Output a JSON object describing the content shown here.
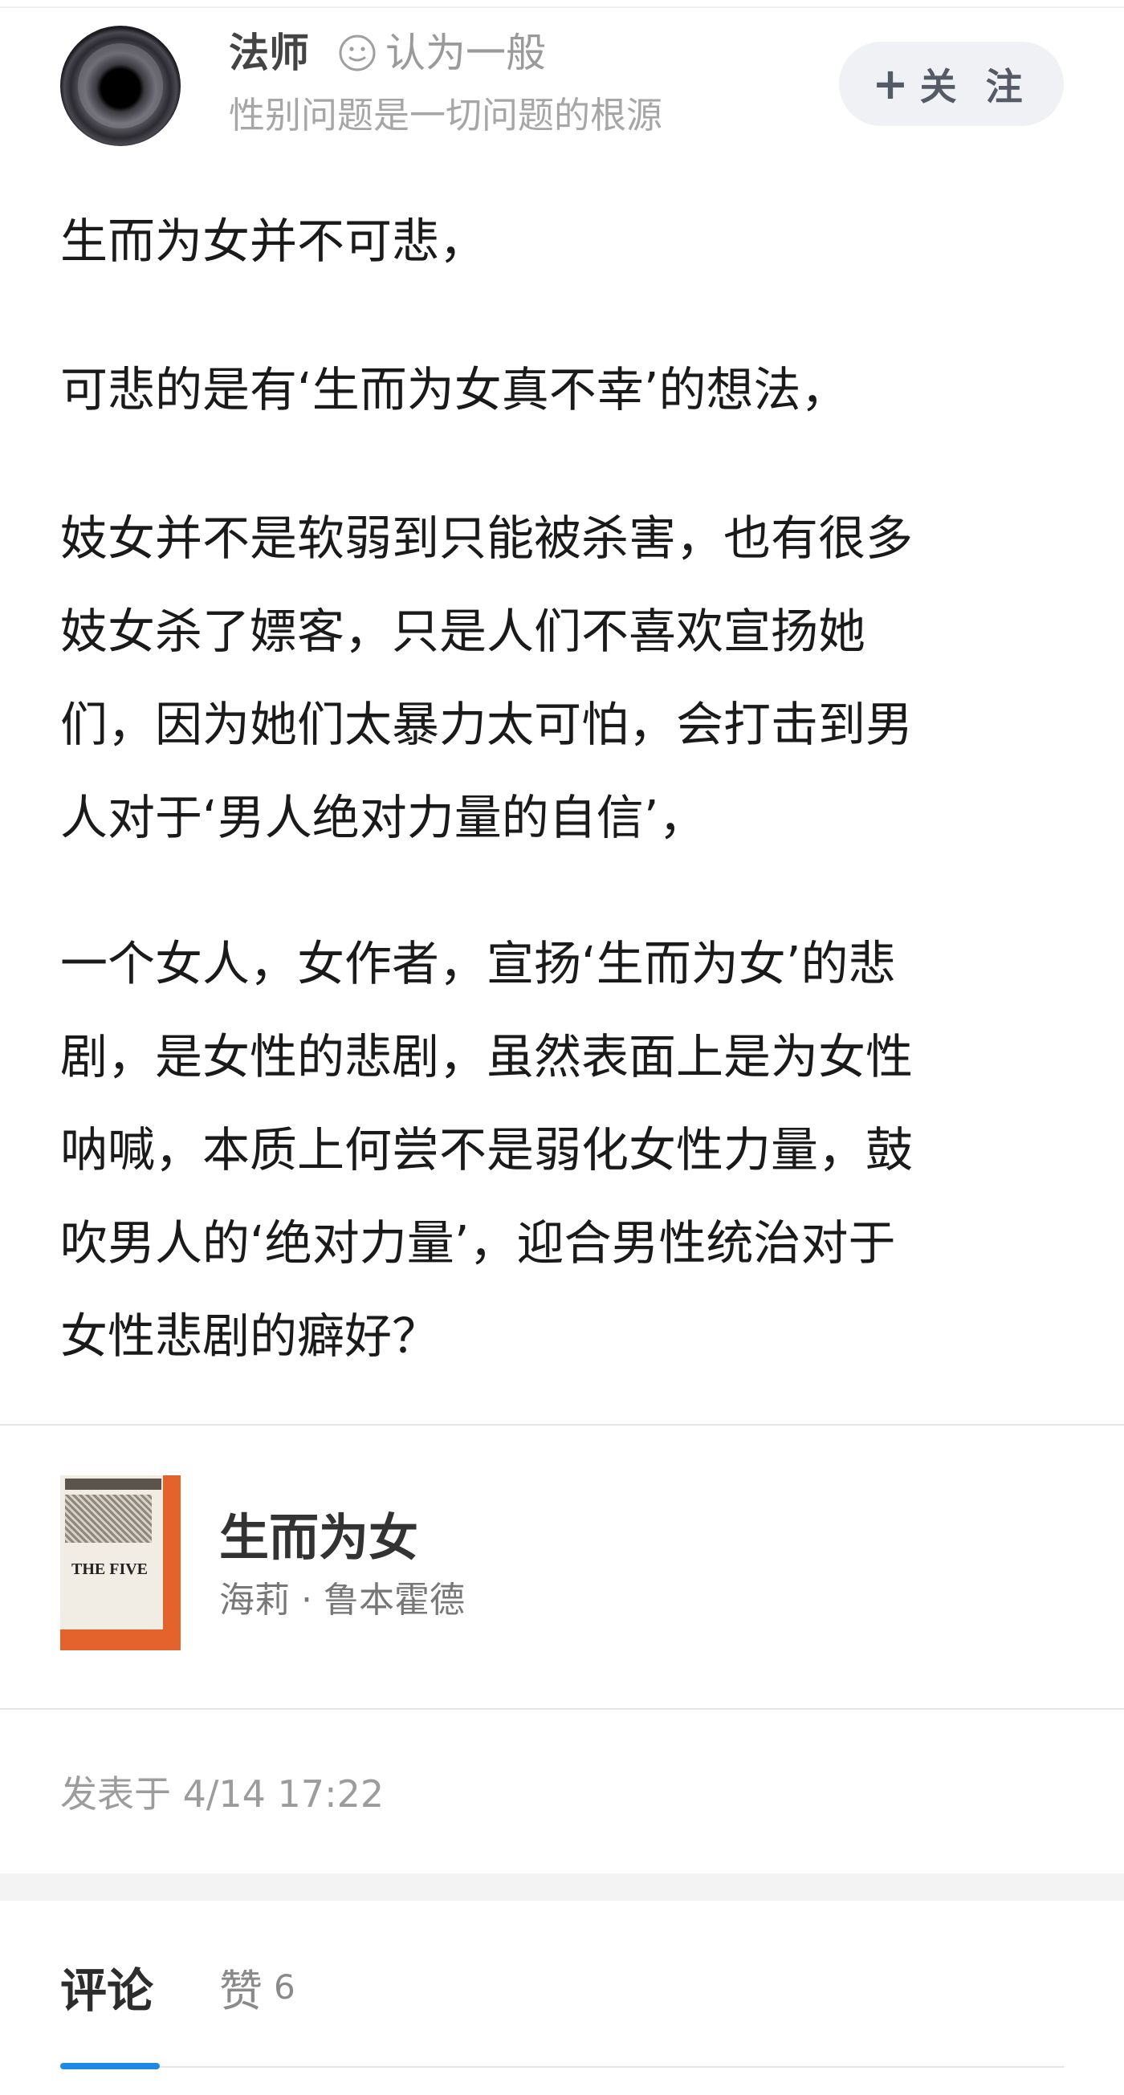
{
  "author": {
    "name": "法师",
    "opinion": "认为一般",
    "bio": "性别问题是一切问题的根源",
    "follow_label": "关 注",
    "follow_icon": "+"
  },
  "post": {
    "paragraphs": [
      "生而为女并不可悲，",
      "可悲的是有‘生而为女真不幸’的想法，",
      "妓女并不是软弱到只能被杀害，也有很多\n妓女杀了嫖客，只是人们不喜欢宣扬她\n们，因为她们太暴力太可怕，会打击到男\n人对于‘男人绝对力量的自信’，",
      "一个女人，女作者，宣扬‘生而为女’的悲\n剧，是女性的悲剧，虽然表面上是为女性\n呐喊，本质上何尝不是弱化女性力量，鼓\n吹男人的‘绝对力量’，迎合男性统治对于\n女性悲剧的癖好？"
    ],
    "published": "发表于 4/14 17:22"
  },
  "book": {
    "title": "生而为女",
    "author": "海莉 · 鲁本霍德",
    "cover_text": "THE FIVE"
  },
  "tabs": {
    "comments_label": "评论",
    "likes_label": "赞",
    "likes_count": "6"
  },
  "colors": {
    "accent": "#1e88e5",
    "cover_orange": "#e4632c"
  }
}
